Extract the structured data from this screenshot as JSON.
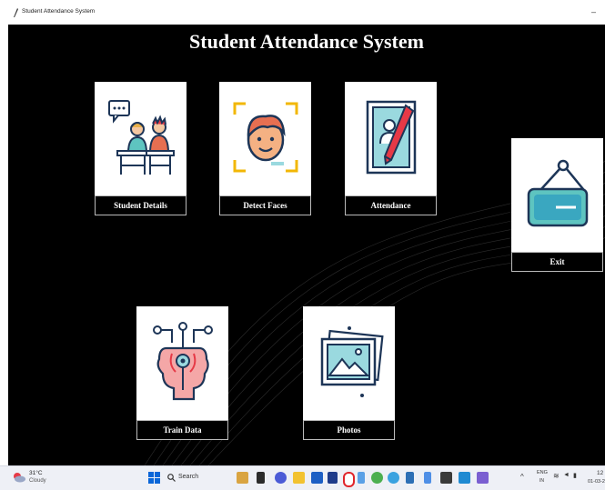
{
  "window": {
    "title": "Student Attendance System",
    "minimize_glyph": "–"
  },
  "app": {
    "heading": "Student Attendance System",
    "tiles": [
      {
        "label": "Student Details",
        "icon": "students-classroom-icon"
      },
      {
        "label": "Detect Faces",
        "icon": "face-detect-icon"
      },
      {
        "label": "Attendance",
        "icon": "attendance-pen-icon"
      },
      {
        "label": "Exit",
        "icon": "exit-sign-icon"
      },
      {
        "label": "Train Data",
        "icon": "brain-network-icon"
      },
      {
        "label": "Photos",
        "icon": "photos-gallery-icon"
      }
    ]
  },
  "taskbar": {
    "weather": {
      "temp": "31°C",
      "condition": "Cloudy"
    },
    "search_label": "Search",
    "tray": {
      "lang": "ENG",
      "region": "IN",
      "time": "12",
      "date": "01-03-2"
    }
  }
}
